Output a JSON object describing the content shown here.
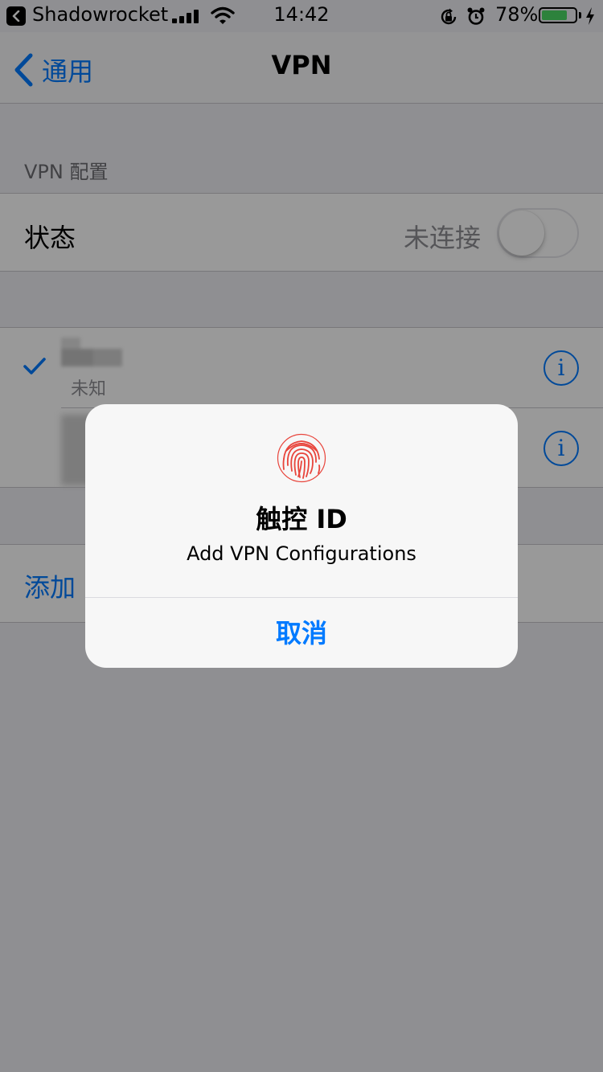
{
  "status_bar": {
    "back_app": "Shadowrocket",
    "time": "14:42",
    "battery_percent": "78%",
    "battery_level": 0.78,
    "icons": [
      "back-arrow-icon",
      "signal-icon",
      "wifi-icon",
      "orientation-lock-icon",
      "alarm-icon",
      "battery-icon",
      "charging-bolt-icon"
    ]
  },
  "navbar": {
    "back_label": "通用",
    "title": "VPN"
  },
  "vpn_config": {
    "header": "VPN 配置",
    "status_label": "状态",
    "status_value": "未连接",
    "toggle_on": false
  },
  "vpn_list": [
    {
      "selected": true,
      "status": "未知"
    },
    {
      "selected": false,
      "status": ""
    }
  ],
  "info_icon_glyph": "i",
  "add_label": "添加",
  "alert": {
    "icon": "fingerprint-icon",
    "title": "触控 ID",
    "message": "Add VPN Configurations",
    "cancel_label": "取消"
  },
  "colors": {
    "accent": "#007aff",
    "battery": "#4cd964",
    "fingerprint": "#e8453c",
    "background": "#efeff4"
  }
}
